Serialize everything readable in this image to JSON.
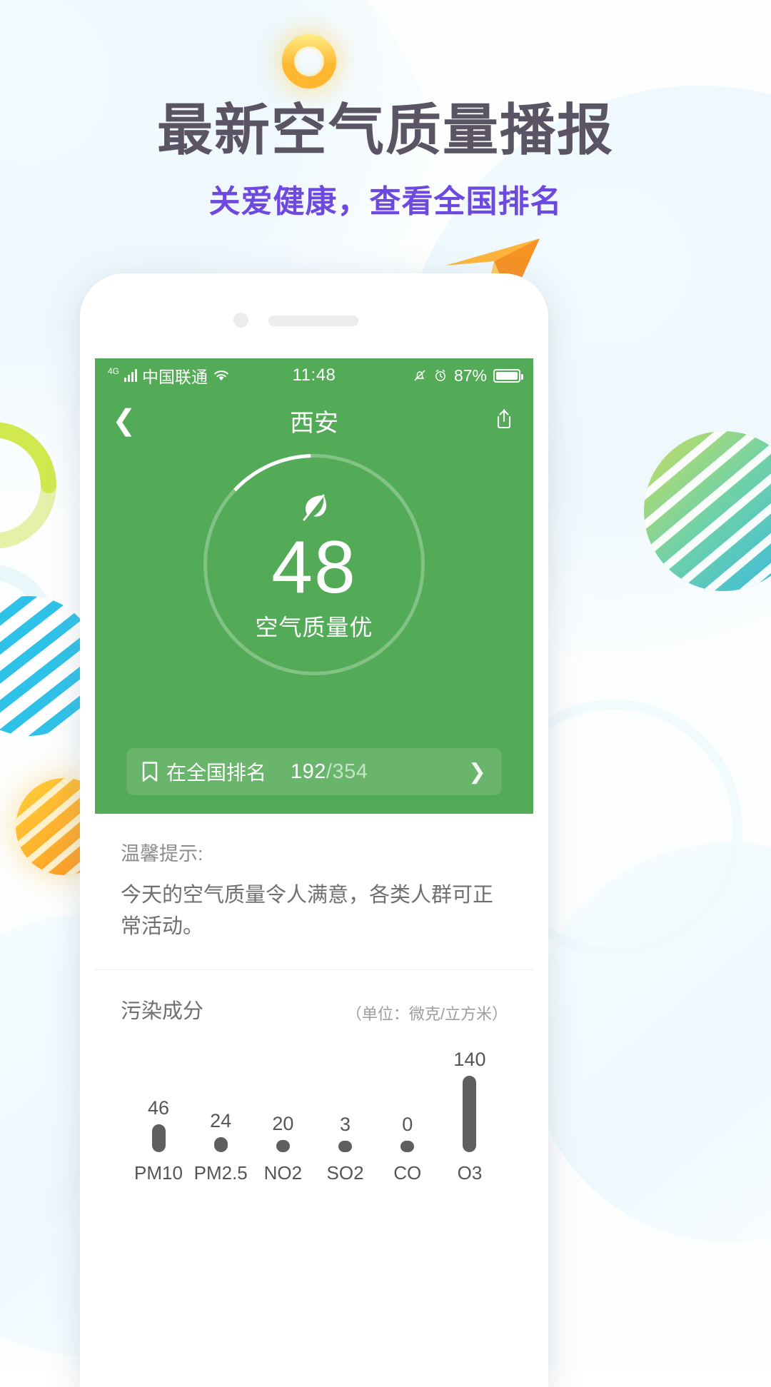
{
  "promo": {
    "title": "最新空气质量播报",
    "subtitle": "关爱健康，查看全国排名",
    "title_color": "#5a5465",
    "subtitle_color": "#6e49e0",
    "sun_icon": "sun-ring-icon",
    "plane_icon": "paper-plane-icon"
  },
  "status_bar": {
    "network_type": "4G",
    "carrier": "中国联通",
    "wifi_icon": "wifi-icon",
    "time": "11:48",
    "alarm_icon": "alarm-icon",
    "mute_icon": "bell-mute-icon",
    "battery_percent": "87%",
    "battery_level": 87,
    "background": "#53ab57"
  },
  "navbar": {
    "back_icon": "chevron-left-icon",
    "title": "西安",
    "share_icon": "share-icon"
  },
  "aqi": {
    "leaf_icon": "leaf-icon",
    "value": "48",
    "label": "空气质量优",
    "arc_percent": 13,
    "card_color": "#53ab57"
  },
  "rank": {
    "bookmark_icon": "bookmark-icon",
    "label": "在全国排名",
    "value": "192",
    "separator": "/",
    "total": "354",
    "chevron_icon": "chevron-right-icon"
  },
  "tips": {
    "title": "温馨提示:",
    "body": "今天的空气质量令人满意，各类人群可正常活动。"
  },
  "pollution": {
    "title": "污染成分",
    "unit": "（单位：微克/立方米）"
  },
  "chart_data": {
    "type": "bar",
    "title": "污染成分",
    "xlabel": "",
    "ylabel": "微克/立方米",
    "categories": [
      "PM10",
      "PM2.5",
      "NO2",
      "SO2",
      "CO",
      "O3"
    ],
    "values": [
      46,
      24,
      20,
      3,
      0,
      140
    ],
    "ylim": [
      0,
      140
    ],
    "grid": false,
    "legend": "none",
    "bar_color": "#5f5f5f",
    "value_labels": [
      "46",
      "24",
      "20",
      "3",
      "0",
      "140"
    ]
  }
}
